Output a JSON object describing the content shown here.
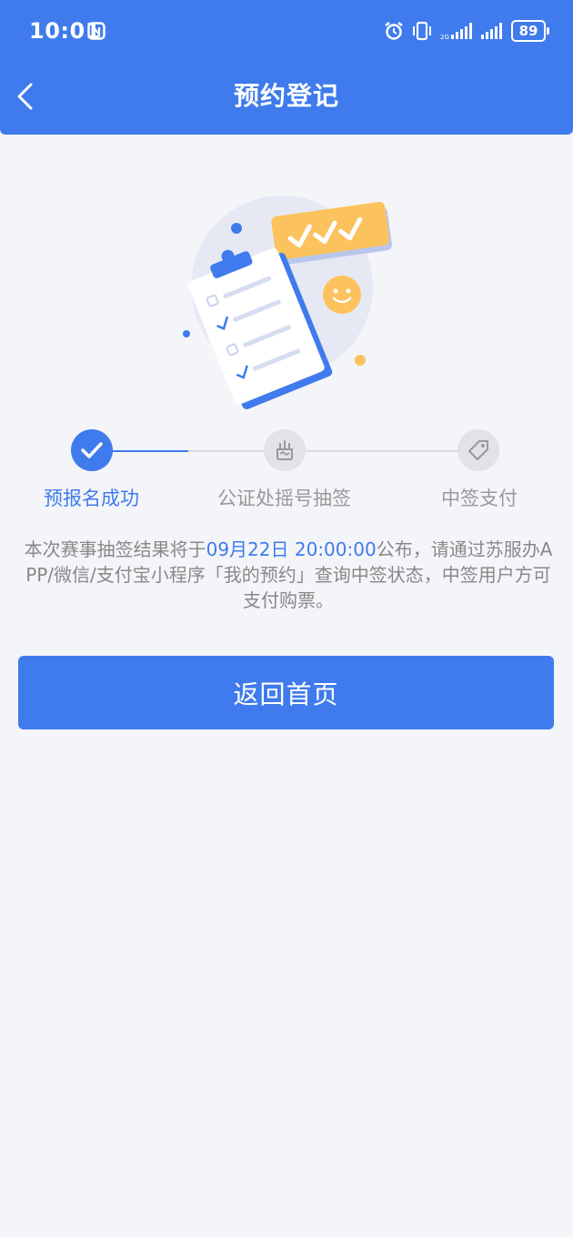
{
  "status_bar": {
    "time": "10:01",
    "battery": "89"
  },
  "header": {
    "title": "预约登记"
  },
  "steps": [
    {
      "label": "预报名成功",
      "state": "done"
    },
    {
      "label": "公证处摇号抽签",
      "state": "pending"
    },
    {
      "label": "中签支付",
      "state": "pending"
    }
  ],
  "notice": {
    "prefix": "本次赛事抽签结果将于",
    "highlight": "09月22日 20:00:00",
    "suffix": "公布，请通过苏服办APP/微信/支付宝小程序「我的预约」查询中签状态，中签用户方可支付购票。"
  },
  "button": {
    "label": "返回首页"
  },
  "colors": {
    "primary": "#3f7bec",
    "background": "#f4f5f9",
    "accent": "#fcc25d"
  }
}
